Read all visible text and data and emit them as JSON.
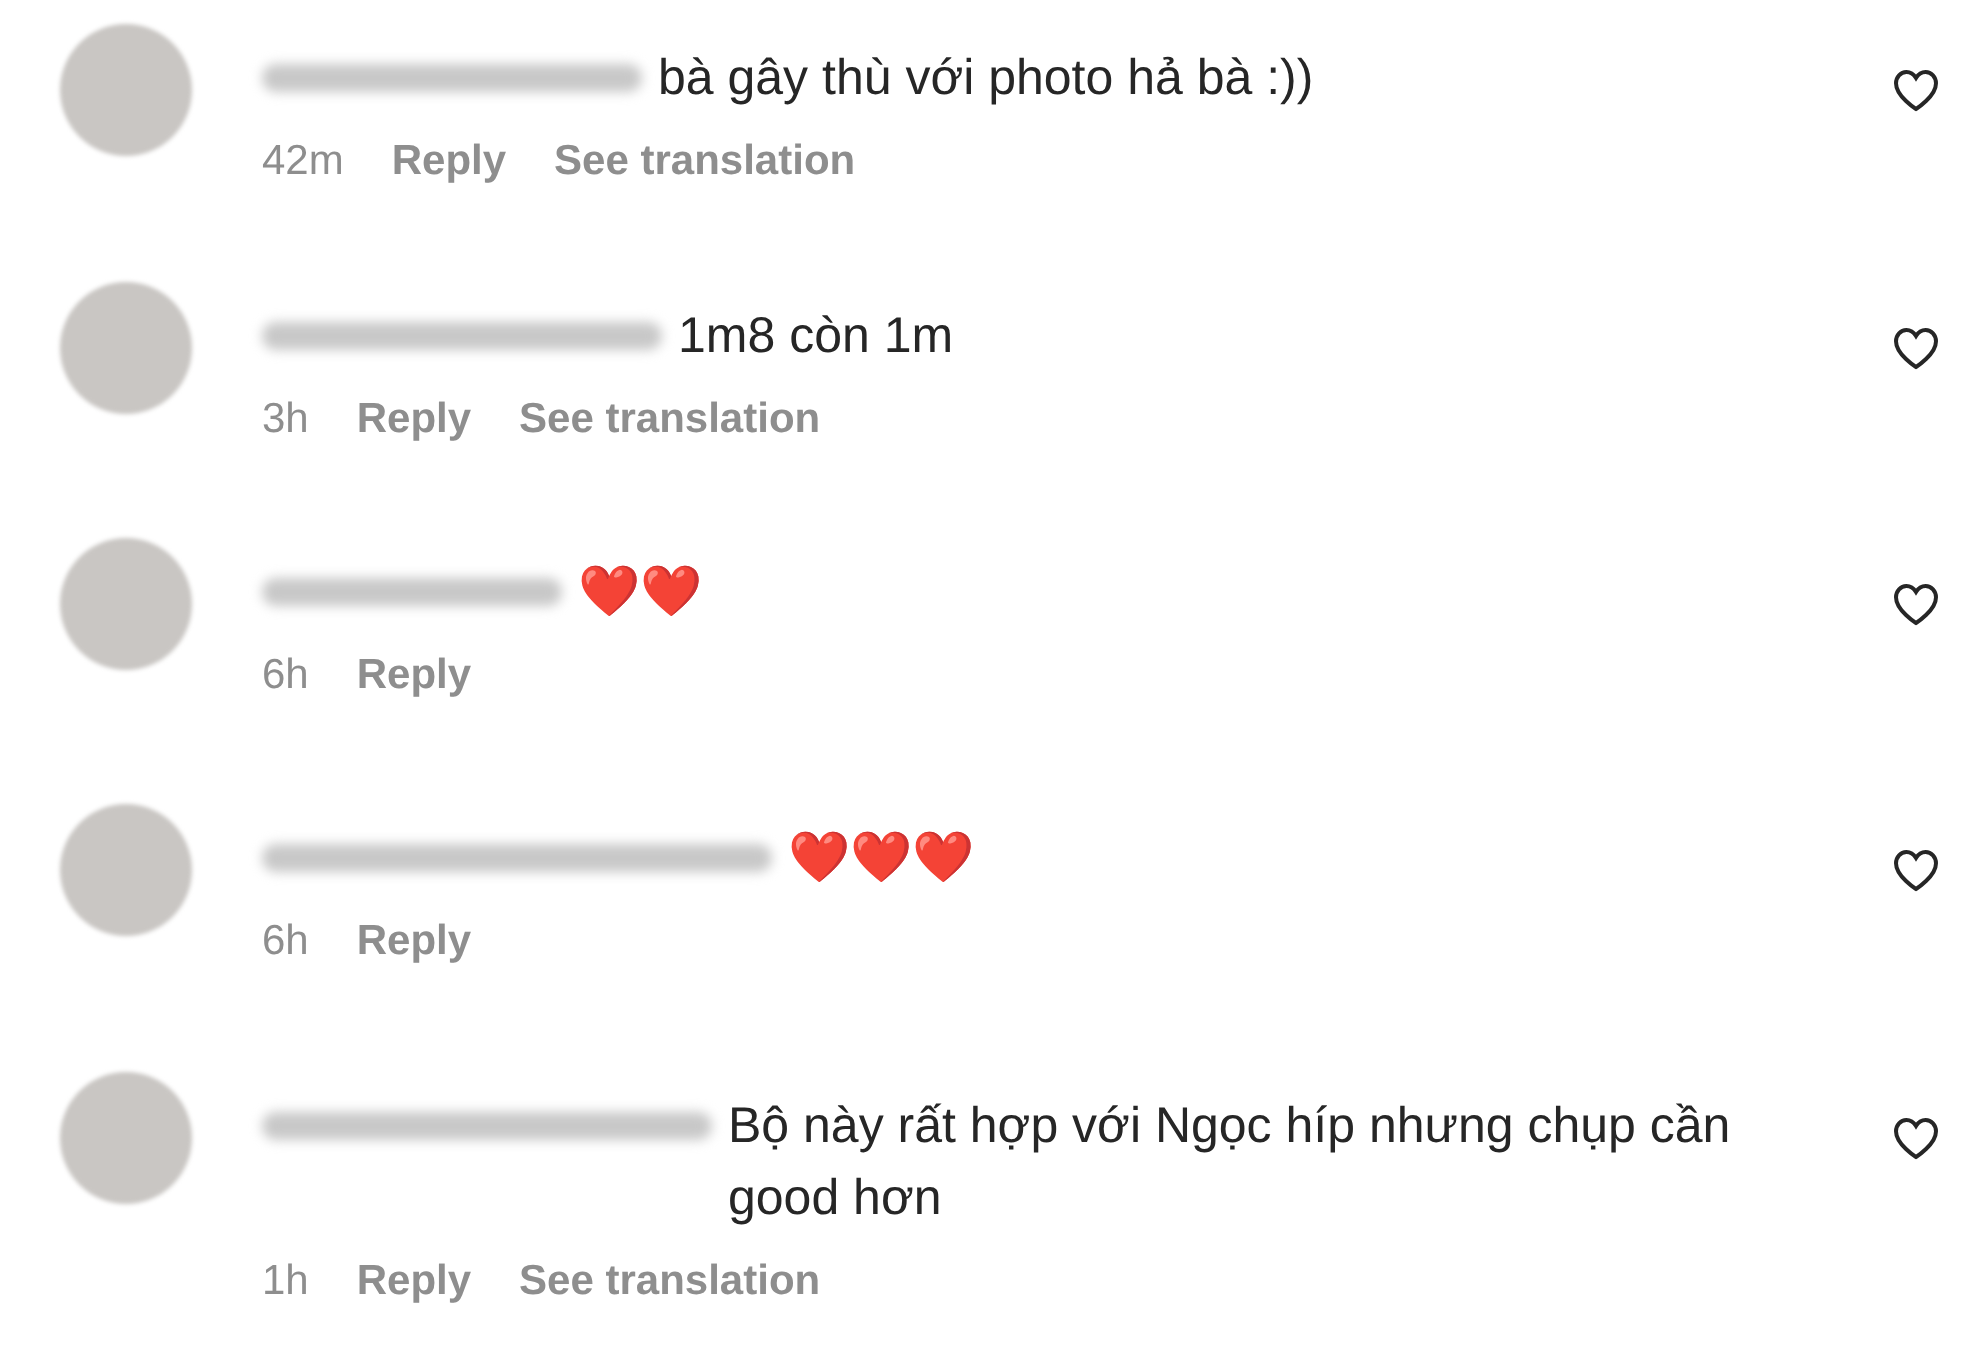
{
  "comments": [
    {
      "text": "bà gây thù với photo hả bà :))",
      "time": "42m",
      "reply": "Reply",
      "translate": "See translation",
      "liked": false
    },
    {
      "text": "1m8 còn 1m",
      "time": "3h",
      "reply": "Reply",
      "translate": "See translation",
      "liked": false
    },
    {
      "text": "❤️❤️",
      "time": "6h",
      "reply": "Reply",
      "liked": false
    },
    {
      "text": "❤️❤️❤️",
      "time": "6h",
      "reply": "Reply",
      "liked": false
    },
    {
      "text": "Bộ này rất hợp với Ngọc híp nhưng chụp cần good hơn",
      "time": "1h",
      "reply": "Reply",
      "translate": "See translation",
      "liked": false
    }
  ]
}
